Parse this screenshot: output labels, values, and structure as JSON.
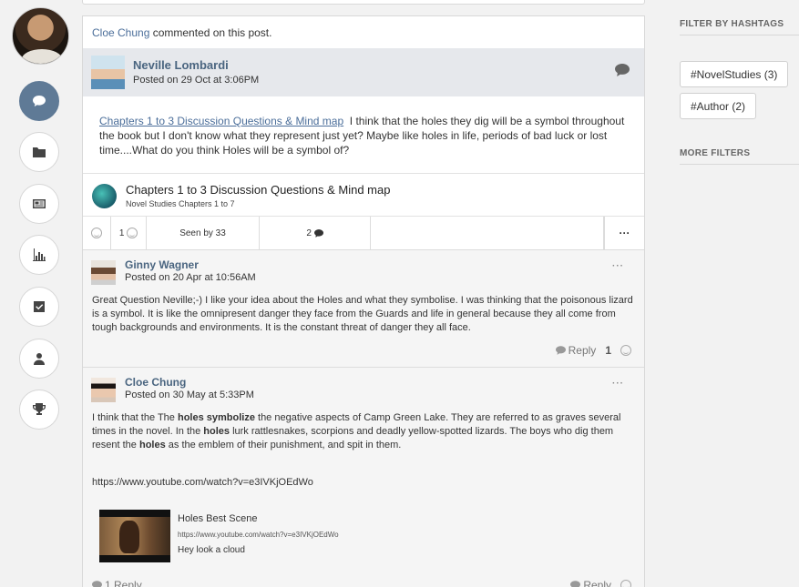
{
  "post": {
    "activity_user": "Cloe Chung",
    "activity_text": "commented on this post.",
    "author": "Neville Lombardi",
    "posted": "Posted on 29 Oct at 3:06PM",
    "link_text": "Chapters 1 to 3 Discussion Questions & Mind map",
    "body": "I think that the holes they dig will be a symbol throughout the book but I don't know what they represent just yet? Maybe like holes in life, periods of bad luck or lost time....What do you think Holes will be a symbol of?",
    "attachment_title": "Chapters 1 to 3 Discussion Questions & Mind map",
    "attachment_sub": "Novel Studies Chapters 1 to 7",
    "actions": {
      "like_count": "1",
      "seen": "Seen by 33",
      "comment_count": "2",
      "more": "···"
    }
  },
  "comments": [
    {
      "name": "Ginny Wagner",
      "date": "Posted on 20 Apr at 10:56AM",
      "text": "Great Question Neville;-) I like your idea about the Holes and what they symbolise. I was thinking that the poisonous lizard is a symbol. It is like the omnipresent danger they face from the Guards and life in general because they all come from tough backgrounds and environments. It is the constant threat of danger they all face.",
      "reply_label": "Reply",
      "like_count": "1",
      "more": "···"
    },
    {
      "name": "Cloe Chung",
      "date": "Posted on 30 May at 5:33PM",
      "text_1": "I think that the The ",
      "bold_1": "holes symbolize",
      "text_2": " the negative aspects of Camp Green Lake. They are referred to as graves several times in the novel. In the ",
      "bold_2": "holes",
      "text_3": " lurk rattlesnakes, scorpions and deadly yellow-spotted lizards. The boys who dig them resent the ",
      "bold_3": "holes",
      "text_4": " as the emblem of their punishment, and spit in them.",
      "url": "https://www.youtube.com/watch?v=e3IVKjOEdWo",
      "video_title": "Holes Best Scene",
      "video_url": "https://www.youtube.com/watch?v=e3IVKjOEdWo",
      "video_desc": "Hey look a cloud",
      "replies": "1 Reply",
      "reply_label": "Reply",
      "more": "···"
    }
  ],
  "sidebar": {
    "filter_heading": "FILTER BY HASHTAGS",
    "tags": [
      "#NovelStudies (3)",
      "#Author (2)"
    ],
    "more_heading": "MORE FILTERS"
  },
  "colors": {
    "accent": "#4a6580",
    "active_rail": "#5f7a96",
    "link": "#4b6e9a"
  }
}
